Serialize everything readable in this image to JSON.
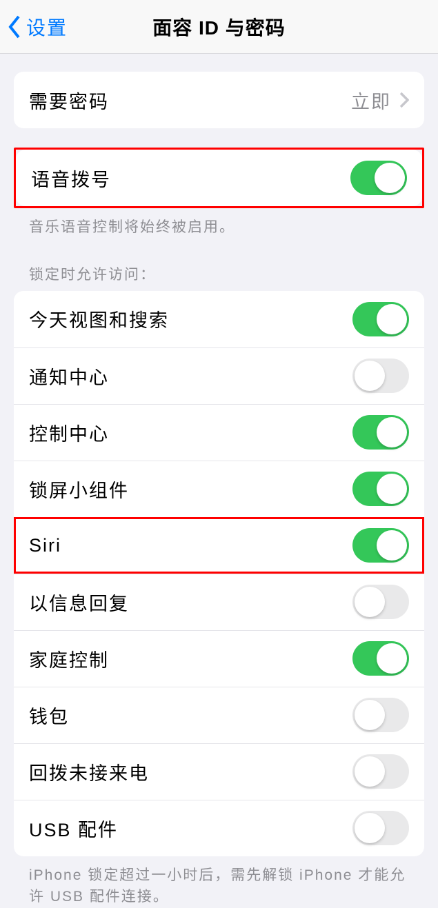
{
  "nav": {
    "back_label": "设置",
    "title": "面容 ID 与密码"
  },
  "group_passcode": {
    "require_label": "需要密码",
    "require_value": "立即"
  },
  "group_voice": {
    "voice_dial_label": "语音拨号",
    "voice_dial_on": true,
    "footer": "音乐语音控制将始终被启用。"
  },
  "group_lock": {
    "header": "锁定时允许访问：",
    "items": [
      {
        "label": "今天视图和搜索",
        "on": true,
        "highlight": false
      },
      {
        "label": "通知中心",
        "on": false,
        "highlight": false
      },
      {
        "label": "控制中心",
        "on": true,
        "highlight": false
      },
      {
        "label": "锁屏小组件",
        "on": true,
        "highlight": false
      },
      {
        "label": "Siri",
        "on": true,
        "highlight": true
      },
      {
        "label": "以信息回复",
        "on": false,
        "highlight": false
      },
      {
        "label": "家庭控制",
        "on": true,
        "highlight": false
      },
      {
        "label": "钱包",
        "on": false,
        "highlight": false
      },
      {
        "label": "回拨未接来电",
        "on": false,
        "highlight": false
      },
      {
        "label": "USB 配件",
        "on": false,
        "highlight": false
      }
    ],
    "footer": "iPhone 锁定超过一小时后，需先解锁 iPhone 才能允许 USB 配件连接。"
  }
}
